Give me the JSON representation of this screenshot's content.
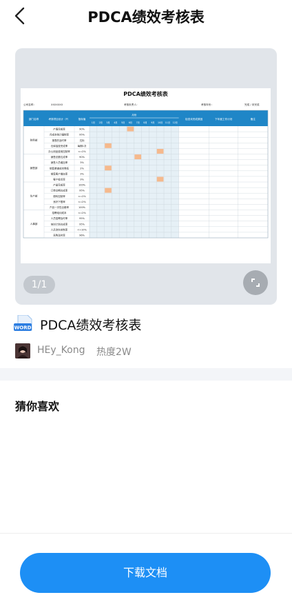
{
  "header": {
    "title": "PDCA绩效考核表"
  },
  "preview": {
    "pager": "1/1",
    "sheet": {
      "title": "PDCA绩效考核表",
      "company_label": "公司名称：",
      "company_value": "XXXXXXX",
      "owner_label": "考核负责人：",
      "period_label": "考核年份：",
      "status_label": "完成 / 未完成",
      "col_dept": "部门名称",
      "col_kpi": "考核项目设计（P）",
      "col_target": "指标值",
      "col_months_group": "月份",
      "months": [
        "1月",
        "2月",
        "3月",
        "4月",
        "5月",
        "6月",
        "7月",
        "8月",
        "9月",
        "10月",
        "11月",
        "12月"
      ],
      "col_check": "检查未完成原因",
      "col_next": "下年度工作计划",
      "col_note": "备注",
      "depts": [
        "财务部",
        "销售部",
        "生产部",
        "人事部"
      ],
      "rows": [
        {
          "kpi": "产值完成率",
          "target": "90%"
        },
        {
          "kpi": "月成本统计编制率",
          "target": "95%"
        },
        {
          "kpi": "报表的及时率",
          "target": "达标"
        },
        {
          "kpi": "仓库抽查完成率",
          "target": "每期1次"
        },
        {
          "kpi": "办公用品费用控制率",
          "target": "<=2%"
        },
        {
          "kpi": "销售总额达成率",
          "target": "90%"
        },
        {
          "kpi": "销售人员增加率",
          "target": "3%"
        },
        {
          "kpi": "销售渠道成本降低",
          "target": "2%"
        },
        {
          "kpi": "销售客户增加率",
          "target": "3%"
        },
        {
          "kpi": "客户投诉率",
          "target": "3%"
        },
        {
          "kpi": "产量完成率",
          "target": "100%"
        },
        {
          "kpi": "订单交期达成率",
          "target": "95%"
        },
        {
          "kpi": "原料控制率",
          "target": "<=2%"
        },
        {
          "kpi": "良好下限率",
          "target": "<=2%"
        },
        {
          "kpi": "产品一次性合格率",
          "target": "100%"
        },
        {
          "kpi": "招聘培训成本",
          "target": "<=2%"
        },
        {
          "kpi": "人员招聘及时率",
          "target": "95%"
        },
        {
          "kpi": "培训计划达成率",
          "target": "95%"
        },
        {
          "kpi": "人员流失控制率",
          "target": "<=10%"
        },
        {
          "kpi": "采购及时率",
          "target": "96%"
        }
      ],
      "highlight_color": "#f5b98d",
      "header_color": "#1f86c7",
      "grid_color": "#e6f0f6"
    }
  },
  "document": {
    "file_type": "WORD",
    "title": "PDCA绩效考核表",
    "author": "HEy_Kong",
    "heat": "热度2W"
  },
  "recommend": {
    "title": "猜你喜欢"
  },
  "footer": {
    "download_label": "下载文档"
  },
  "colors": {
    "accent": "#1d8ff5"
  }
}
